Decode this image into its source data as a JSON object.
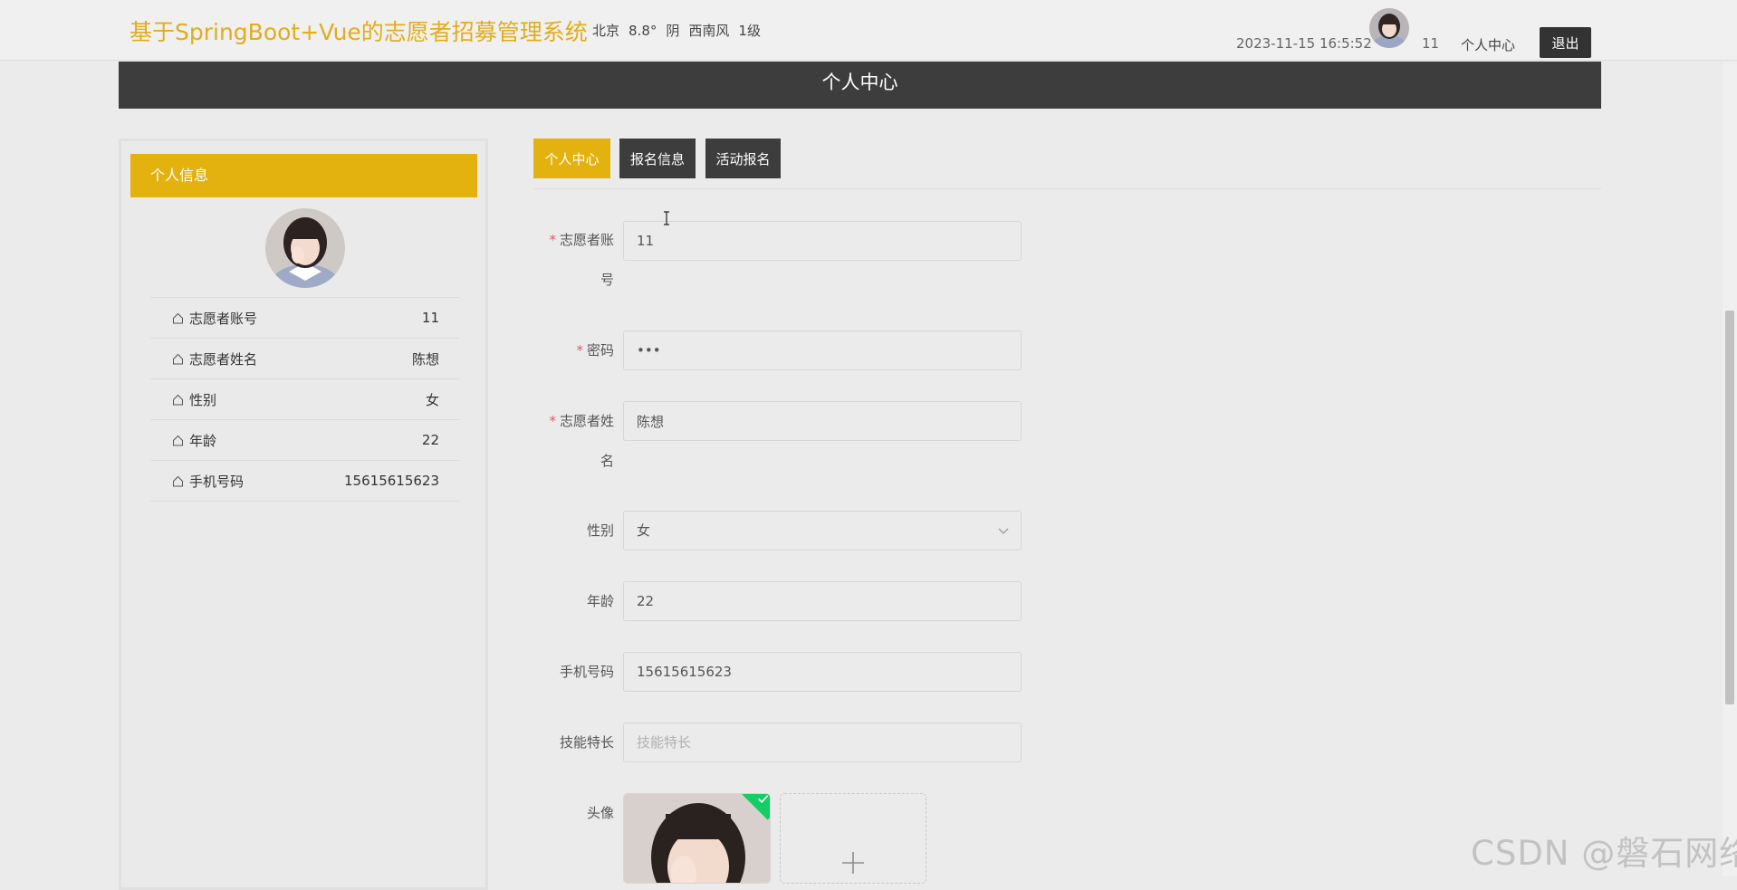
{
  "header": {
    "site_title": "基于SpringBoot+Vue的志愿者招募管理系统",
    "weather": {
      "city": "北京",
      "temperature": "8.8°",
      "condition": "阴",
      "wind": "西南风",
      "level": "1级"
    },
    "datetime": "2023-11-15 16:5:52",
    "username": "11",
    "profile_link": "个人中心",
    "logout_label": "退出"
  },
  "banner": {
    "title": "个人中心"
  },
  "sidebar": {
    "title": "个人信息",
    "items": [
      {
        "label": "志愿者账号",
        "value": "11"
      },
      {
        "label": "志愿者姓名",
        "value": "陈想"
      },
      {
        "label": "性别",
        "value": "女"
      },
      {
        "label": "年龄",
        "value": "22"
      },
      {
        "label": "手机号码",
        "value": "15615615623"
      }
    ]
  },
  "tabs": {
    "center": "个人中心",
    "signup_info": "报名信息",
    "activity_signup": "活动报名"
  },
  "form": {
    "account": {
      "label_line1": "志愿者账",
      "label_line2": "号",
      "value": "11"
    },
    "password": {
      "label": "密码",
      "value": "•••"
    },
    "name": {
      "label_line1": "志愿者姓",
      "label_line2": "名",
      "value": "陈想"
    },
    "gender": {
      "label": "性别",
      "value": "女"
    },
    "age": {
      "label": "年龄",
      "value": "22"
    },
    "phone": {
      "label": "手机号码",
      "value": "15615615623"
    },
    "skills": {
      "label": "技能特长",
      "value": "",
      "placeholder": "技能特长"
    },
    "avatar": {
      "label": "头像"
    }
  },
  "watermark": "CSDN @磐石网络",
  "colors": {
    "accent": "#e3b20f",
    "dark": "#3d3d3d",
    "title": "#e1ad1d",
    "success": "#13ce66"
  }
}
